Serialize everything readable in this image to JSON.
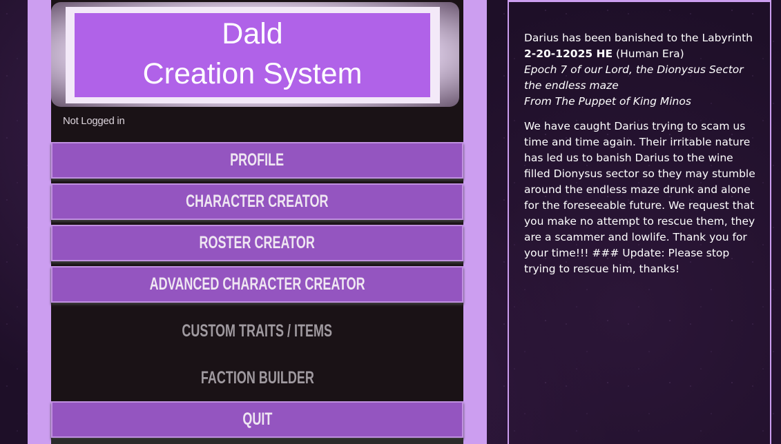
{
  "logo": {
    "line1": "Dald",
    "line2": "Creation System"
  },
  "login_status": "Not Logged in",
  "menu": {
    "profile": "PROFILE",
    "character_creator": "CHARACTER CREATOR",
    "roster_creator": "ROSTER CREATOR",
    "advanced_character_creator": "ADVANCED CHARACTER CREATOR",
    "custom_traits_items": "CUSTOM TRAITS / ITEMS",
    "faction_builder": "FACTION BUILDER",
    "quit": "QUIT"
  },
  "news": {
    "headline": "Darius has been banished to the Labyrinth",
    "date": "2-20-12025 HE",
    "era": " (Human Era)",
    "epoch": "Epoch 7 of our Lord, the Dionysus Sector the endless maze",
    "from": "From The Puppet of King Minos",
    "body": "We have caught Darius trying to scam us time and time again.  Their irritable nature has led us to banish Darius to the wine filled Dionysus sector so they may stumble around the endless maze drunk and alone for the foreseeable future.  We request that you make no attempt to rescue them, they are a scammer and lowlife.  Thank you for your time!!!  ### Update: Please stop trying to rescue him, thanks!"
  },
  "colors": {
    "panel": "#cc9ef0",
    "button": "#9455c0",
    "logo_bg": "#b062e8",
    "dark": "#1a1216"
  }
}
